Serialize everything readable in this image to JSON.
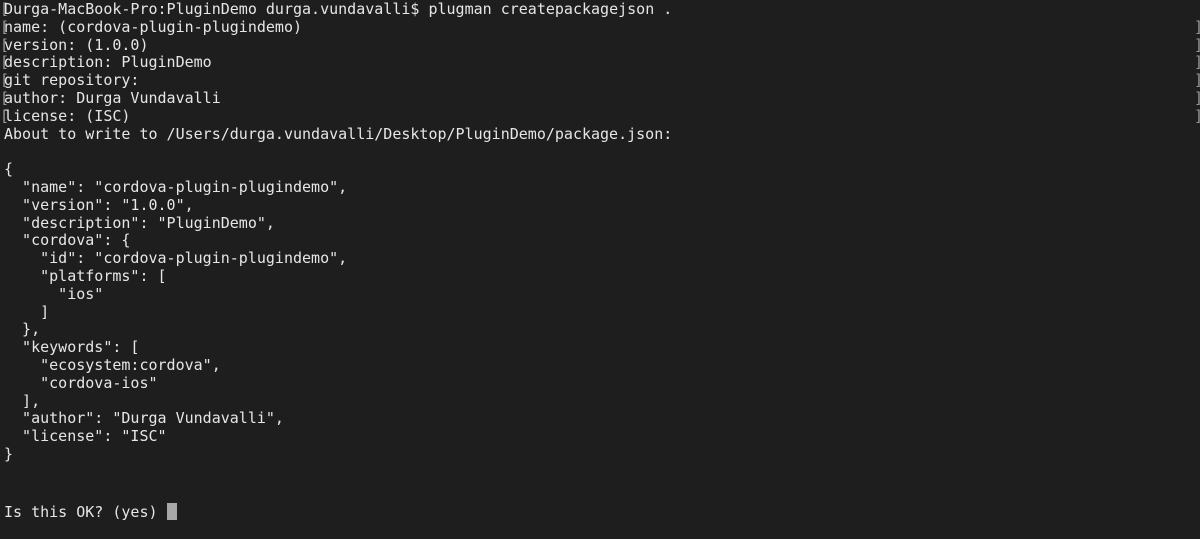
{
  "terminal": {
    "background": "#1e1e1e",
    "foreground": "#e6e6e6",
    "cursor_color": "#a8a8a8",
    "prompt": {
      "host_dir": "Durga-MacBook-Pro:PluginDemo durga.vundavalli$",
      "command": "plugman createpackagejson ."
    },
    "answers": {
      "name": "name: (cordova-plugin-plugindemo)",
      "version": "version: (1.0.0)",
      "description": "description: PluginDemo",
      "git": "git repository:",
      "author": "author: Durga Vundavalli",
      "license": "license: (ISC)"
    },
    "write_notice": "About to write to /Users/durga.vundavalli/Desktop/PluginDemo/package.json:",
    "json_lines": [
      "{",
      "  \"name\": \"cordova-plugin-plugindemo\",",
      "  \"version\": \"1.0.0\",",
      "  \"description\": \"PluginDemo\",",
      "  \"cordova\": {",
      "    \"id\": \"cordova-plugin-plugindemo\",",
      "    \"platforms\": [",
      "      \"ios\"",
      "    ]",
      "  },",
      "  \"keywords\": [",
      "    \"ecosystem:cordova\",",
      "    \"cordova-ios\"",
      "  ],",
      "  \"author\": \"Durga Vundavalli\",",
      "  \"license\": \"ISC\"",
      "}"
    ],
    "confirm_prompt": "Is this OK? (yes)"
  }
}
